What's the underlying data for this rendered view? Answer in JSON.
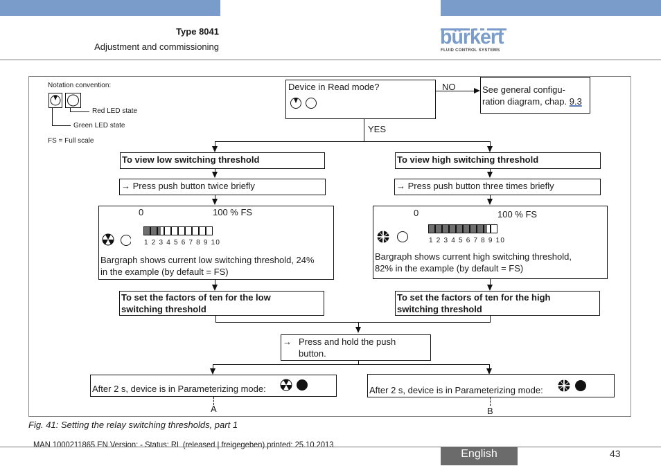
{
  "header": {
    "type_label": "Type 8041",
    "section": "Adjustment and commissioning",
    "logo_word": "bürkert",
    "logo_tagline": "FLUID CONTROL SYSTEMS",
    "accent_color": "#7a9ccb"
  },
  "notation": {
    "title": "Notation convention:",
    "red_led": "Red LED state",
    "green_led": "Green LED state",
    "fs_note": "FS = Full scale"
  },
  "flow": {
    "decision": "Device in Read mode?",
    "no_label": "NO",
    "yes_label": "YES",
    "see_general_line1": "See general configu-",
    "see_general_line2": "ration diagram, chap. ",
    "see_general_chapter": "9.3",
    "low": {
      "title": "To view low switching threshold",
      "action": "Press push button twice briefly",
      "scale_zero": "0",
      "scale_full": "100 % FS",
      "bar_numbers": "1 2 3 4 5 6 7 8 9 10",
      "bargraph_fill_percent": 24,
      "description_line1": "Bargraph shows current low switching threshold, 24%",
      "description_line2": "in the example (by default = FS)",
      "factors_line1": "To set the factors of ten for the low",
      "factors_line2": "switching threshold",
      "led_green": "blinking-sector-3",
      "led_red": "off"
    },
    "high": {
      "title": "To view high switching threshold",
      "action": "Press push button three times briefly",
      "scale_zero": "0",
      "scale_full": "100 % FS",
      "bar_numbers": "1 2 3 4 5 6 7 8 9 10",
      "bargraph_fill_percent": 82,
      "description_line1": "Bargraph shows current high switching threshold,",
      "description_line2": "82% in the example (by default = FS)",
      "factors_line1": "To set the factors of ten for the high",
      "factors_line2": "switching threshold",
      "led_green": "blinking-sector-4",
      "led_red": "off"
    },
    "press_hold_line1": "Press and hold the push",
    "press_hold_line2": "button.",
    "arrow_glyph": "→",
    "param_mode_text": "After 2 s, device is in Parameterizing mode:",
    "connector_a": "A",
    "connector_b": "B"
  },
  "caption": "Fig. 41:  Setting the relay switching thresholds, part 1",
  "footer": {
    "doc_info": "MAN  1000211865  EN  Version: - Status: RL (released | freigegeben)  printed: 25.10.2013",
    "language": "English",
    "page_number": "43"
  }
}
